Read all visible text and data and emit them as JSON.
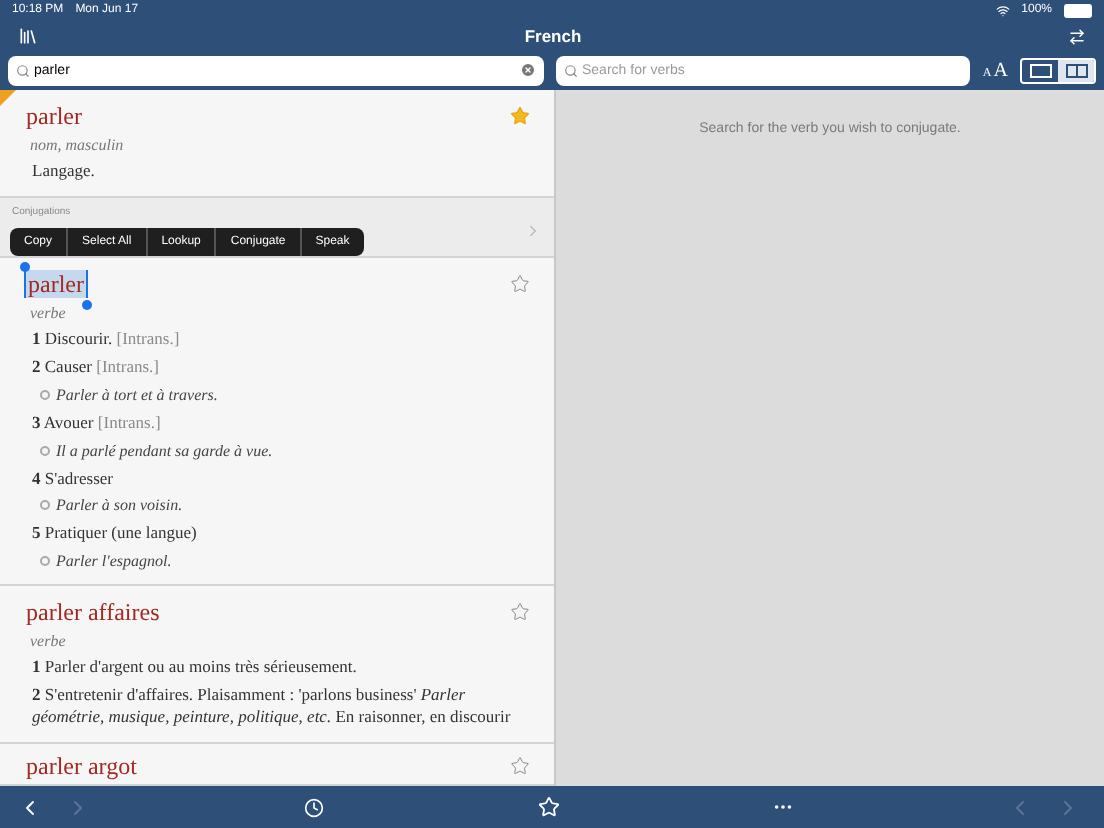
{
  "status_bar": {
    "time": "10:18 PM",
    "date": "Mon Jun 17",
    "battery": "100%"
  },
  "nav": {
    "title": "French"
  },
  "search": {
    "value": "parler"
  },
  "verb_search": {
    "placeholder": "Search for verbs"
  },
  "text_size": {
    "small": "A",
    "large": "A"
  },
  "layout_modes": [
    {
      "kind": "single",
      "selected": false
    },
    {
      "kind": "split",
      "selected": true
    }
  ],
  "entries": [
    {
      "kind": "entry",
      "headword": "parler",
      "pos": "nom, masculin",
      "favorite": true,
      "selected": false,
      "recent": true,
      "senses": [
        {
          "kind": "plain",
          "text": "Langage."
        }
      ]
    },
    {
      "kind": "conjugations",
      "label": "Conjugations"
    },
    {
      "kind": "entry",
      "headword": "parler",
      "pos": "verbe",
      "favorite": false,
      "selected": true,
      "recent": false,
      "senses": [
        {
          "kind": "sense",
          "number": "1",
          "text": "Discourir.",
          "tag": "[Intrans.]"
        },
        {
          "kind": "sense",
          "number": "2",
          "text": "Causer",
          "tag": "[Intrans.]"
        },
        {
          "kind": "example",
          "text": "Parler à tort et à travers."
        },
        {
          "kind": "sense",
          "number": "3",
          "text": "Avouer",
          "tag": "[Intrans.]"
        },
        {
          "kind": "example",
          "text": "Il a parlé pendant sa garde à vue."
        },
        {
          "kind": "sense",
          "number": "4",
          "text": "S'adresser"
        },
        {
          "kind": "example",
          "text": "Parler à son voisin."
        },
        {
          "kind": "sense",
          "number": "5",
          "text": "Pratiquer (une langue)"
        },
        {
          "kind": "example",
          "text": "Parler l'espagnol."
        }
      ]
    },
    {
      "kind": "entry",
      "headword": "parler affaires",
      "pos": "verbe",
      "favorite": false,
      "selected": false,
      "recent": false,
      "senses": [
        {
          "kind": "sense",
          "number": "1",
          "text": "Parler d'argent ou au moins très sérieusement."
        },
        {
          "kind": "sense",
          "number": "2",
          "text": "S'entretenir d'affaires. Plaisamment : 'parlons business' *Parler géométrie, musique, peinture, politique, etc.* En raisonner, en discourir"
        }
      ]
    },
    {
      "kind": "entry",
      "headword": "parler argot",
      "favorite": false,
      "selected": false,
      "recent": false
    }
  ],
  "context_menu": [
    "Copy",
    "Select All",
    "Lookup",
    "Conjugate",
    "Speak"
  ],
  "conjugation_hint": "Search for the verb you wish to conjugate.",
  "toolbar": {
    "back_disabled": false,
    "forward_disabled": true,
    "right_back_disabled": true,
    "right_forward_disabled": true
  }
}
